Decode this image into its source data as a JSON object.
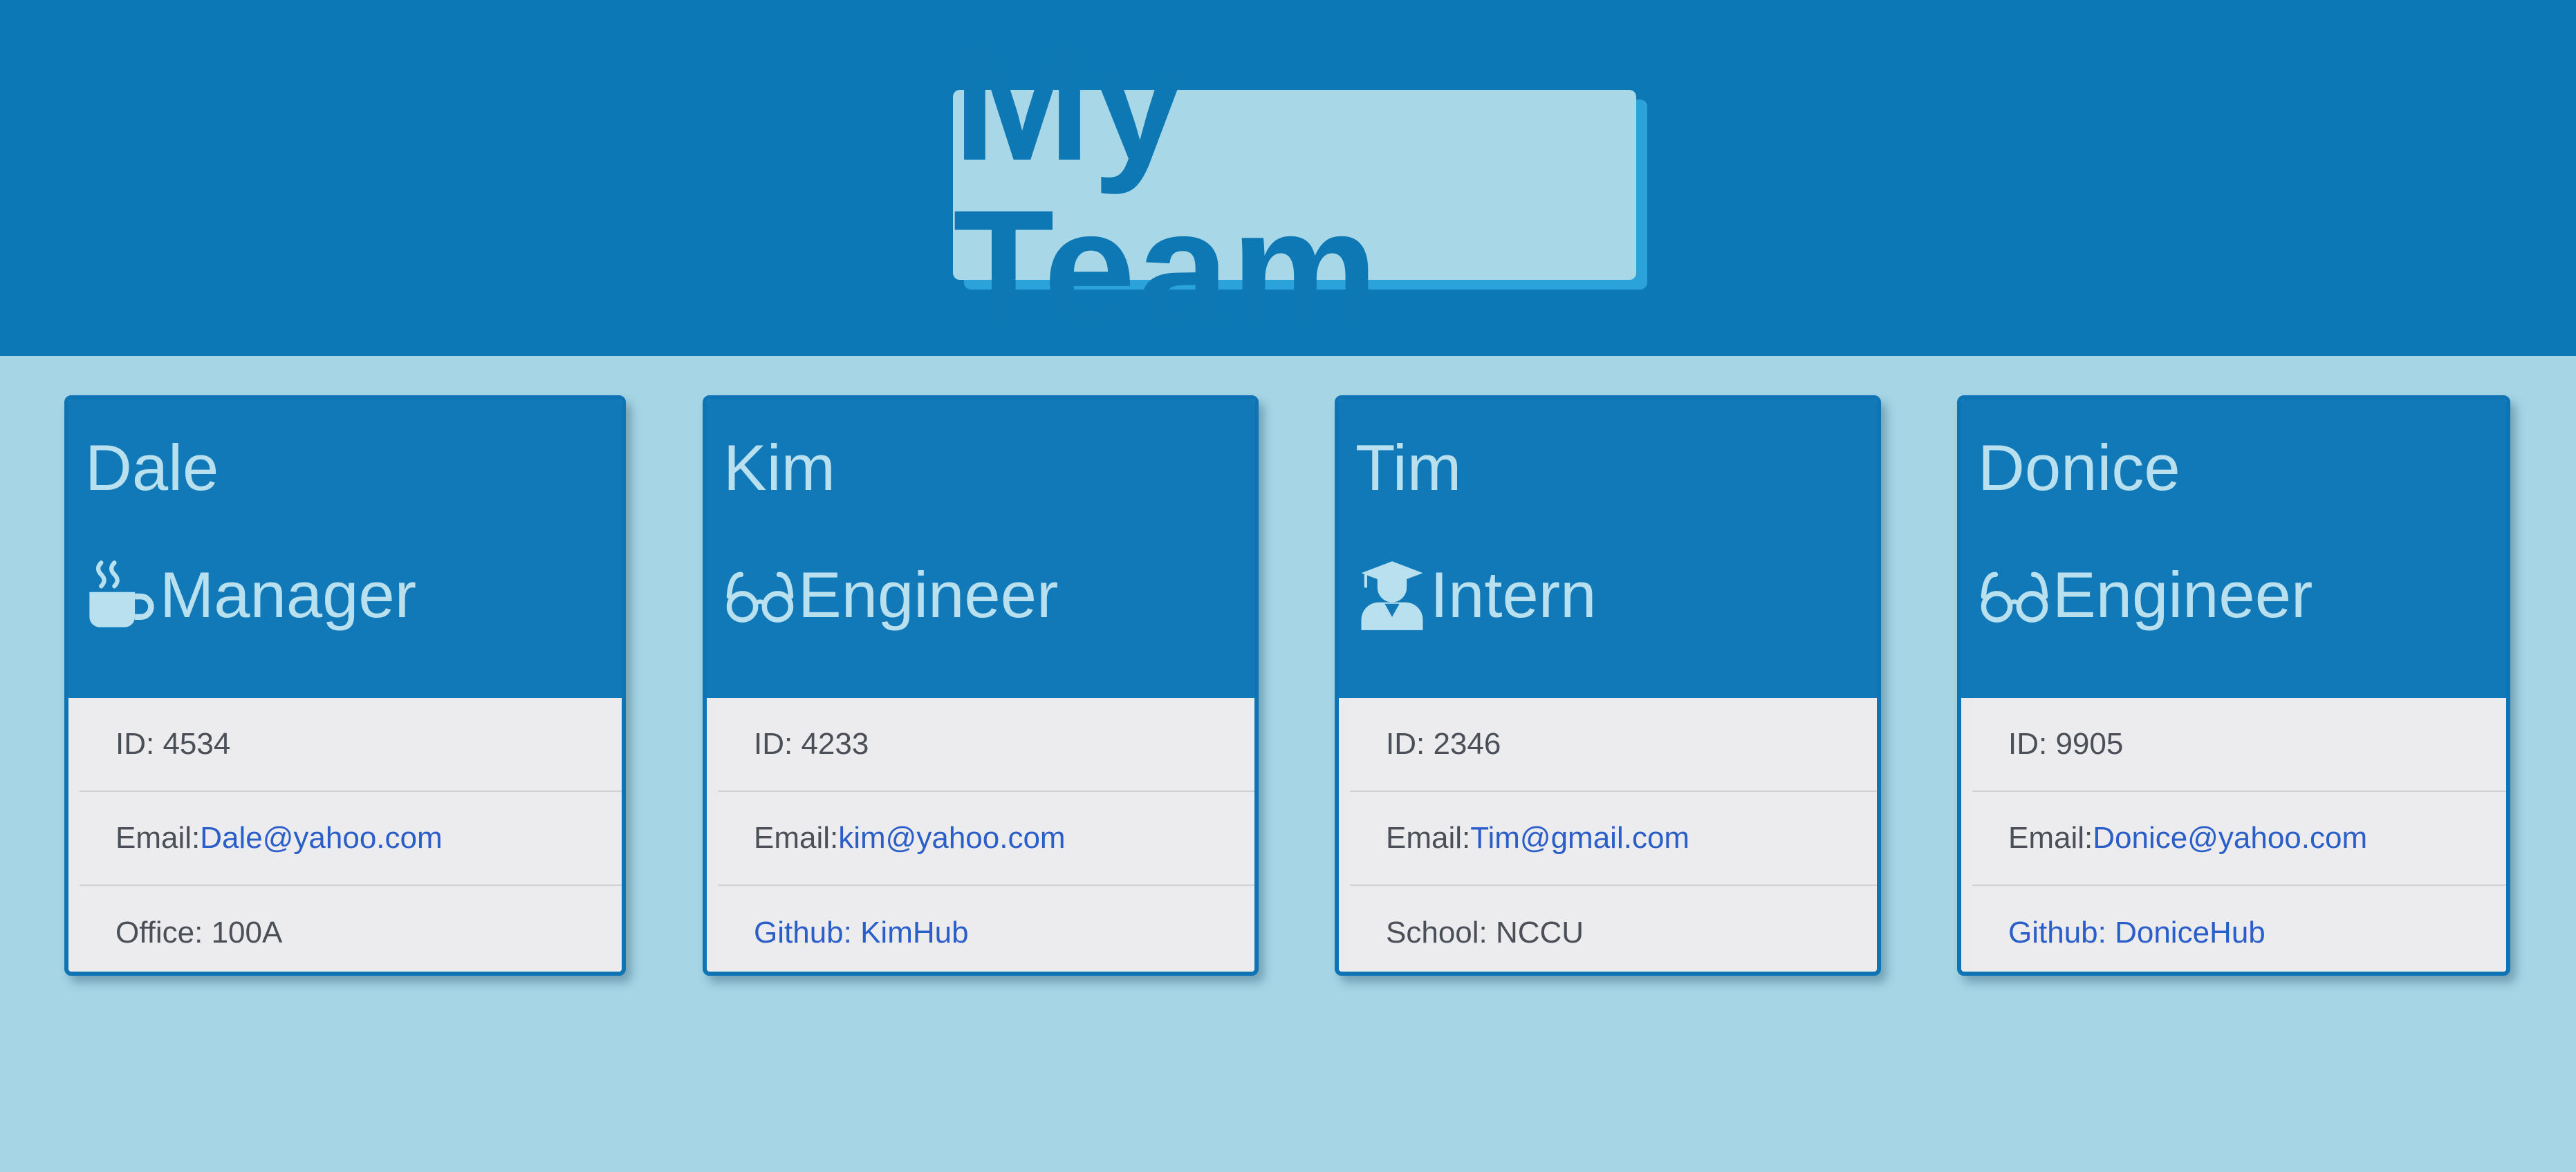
{
  "header": {
    "title": "My Team"
  },
  "colors": {
    "header_bg": "#0d78b6",
    "page_bg": "#a6d6e6",
    "card_head_bg": "#1279b8",
    "card_head_text": "#b8e0ee",
    "list_bg": "#ecebed",
    "link": "#2a5ec9"
  },
  "cards": [
    {
      "name": "Dale",
      "role": "Manager",
      "role_icon": "mug-hot-icon",
      "id_label": "ID: 4534",
      "email_label": "Email:",
      "email": "Dale@yahoo.com",
      "extra_label": "Office: 100A"
    },
    {
      "name": "Kim",
      "role": "Engineer",
      "role_icon": "glasses-icon",
      "id_label": "ID: 4233",
      "email_label": "Email:",
      "email": "kim@yahoo.com",
      "extra_label": "Github: KimHub"
    },
    {
      "name": "Tim",
      "role": "Intern",
      "role_icon": "user-graduate-icon",
      "id_label": "ID: 2346",
      "email_label": "Email:",
      "email": "Tim@gmail.com",
      "extra_label": "School: NCCU"
    },
    {
      "name": "Donice",
      "role": "Engineer",
      "role_icon": "glasses-icon",
      "id_label": "ID: 9905",
      "email_label": "Email:",
      "email": "Donice@yahoo.com",
      "extra_label": "Github: DoniceHub"
    }
  ]
}
